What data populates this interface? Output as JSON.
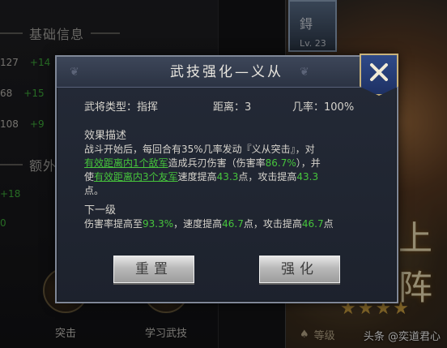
{
  "background": {
    "section_basic_info": "基础信息",
    "section_extra": "额外",
    "stats": [
      {
        "value": "127",
        "bonus": "+14"
      },
      {
        "value": "68",
        "bonus": "+15"
      },
      {
        "value": "108",
        "bonus": "+9"
      }
    ],
    "extra_stats": [
      "+18",
      "0"
    ],
    "hero_card_char": "鍀",
    "hero_card_level": "Lv. 23",
    "hero_big_text": "上阵",
    "stars": "★★★★",
    "grade_label": "等级",
    "bottom_buttons": [
      "突击",
      "学习武技"
    ],
    "watermark": "头条 @奕道君心"
  },
  "dialog": {
    "title": "武技强化—义从",
    "info": {
      "general_type": "武将类型：指挥",
      "distance": "距离：3",
      "probability": "几率：100%"
    },
    "effect_title": "效果描述",
    "effect": {
      "p1": "战斗开始后，每回合有35%几率发动『义从突击』，对",
      "p2_green": "有效距离内1个敌军",
      "p2_rest": "造成兵刃伤害（伤害率",
      "p2_val": "86.7%",
      "p2_end": "），并",
      "p3_pre": "使",
      "p3_green": "有效距离内3个友军",
      "p3_mid": "速度提高",
      "p3_val1": "43.3",
      "p3_mid2": "点，攻击提高",
      "p3_val2": "43.3",
      "p3_end": "点。"
    },
    "next_title": "下一级",
    "next": {
      "pre": "伤害率提高至",
      "val1": "93.3%",
      "mid1": "，速度提高",
      "val2": "46.7",
      "mid2": "点，攻击提高",
      "val3": "46.7",
      "end": "点"
    },
    "reset_label": "重置",
    "upgrade_label": "强化",
    "close_icon": "close-x-icon"
  },
  "colors": {
    "accent_green": "#46c43c",
    "dialog_bg": "#1d222d",
    "close_gold": "#c8b27a"
  }
}
